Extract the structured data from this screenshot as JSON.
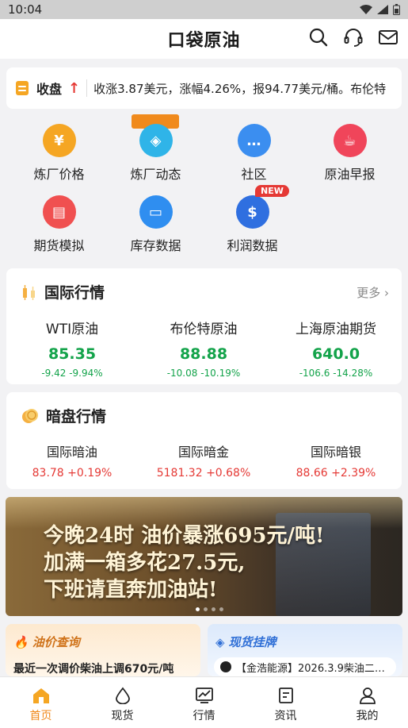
{
  "status": {
    "time": "10:04"
  },
  "header": {
    "logo_text": "口袋原油"
  },
  "ticker": {
    "label": "收盘",
    "text": "收涨3.87美元，涨幅4.26%，报94.77美元/桶。布伦特"
  },
  "grid": [
    {
      "label": "炼厂价格",
      "icon": "refinery-price-icon",
      "color": "#f5a623",
      "glyph": "¥"
    },
    {
      "label": "炼厂动态",
      "icon": "compass-icon",
      "color": "#2fb4e8",
      "glyph": "◈"
    },
    {
      "label": "社区",
      "icon": "chat-icon",
      "color": "#3b8ef0",
      "glyph": "…"
    },
    {
      "label": "原油早报",
      "icon": "cup-icon",
      "color": "#f0455a",
      "glyph": "☕"
    },
    {
      "label": "期货模拟",
      "icon": "gold-bars-icon",
      "color": "#f05050",
      "glyph": "▤"
    },
    {
      "label": "库存数据",
      "icon": "monitor-icon",
      "color": "#2f8ef0",
      "glyph": "▭"
    },
    {
      "label": "利润数据",
      "icon": "dollar-icon",
      "color": "#2f6fe0",
      "glyph": "$",
      "badge": "NEW"
    }
  ],
  "intl": {
    "title": "国际行情",
    "more": "更多",
    "items": [
      {
        "name": "WTI原油",
        "price": "85.35",
        "change": "-9.42  -9.94%"
      },
      {
        "name": "布伦特原油",
        "price": "88.88",
        "change": "-10.08  -10.19%"
      },
      {
        "name": "上海原油期货",
        "price": "640.0",
        "change": "-106.6  -14.28%"
      }
    ]
  },
  "dark": {
    "title": "暗盘行情",
    "items": [
      {
        "name": "国际暗油",
        "value": "83.78 +0.19%"
      },
      {
        "name": "国际暗金",
        "value": "5181.32 +0.68%"
      },
      {
        "name": "国际暗银",
        "value": "88.66 +2.39%"
      }
    ]
  },
  "banner": {
    "line1": "今晚24时 油价暴涨695元/吨!",
    "line2": "加满一箱多花27.5元,",
    "line3": "下班请直奔加油站!"
  },
  "promo_left": {
    "title": "油价查询",
    "subtitle": "最近一次调价柴油上调670元/吨"
  },
  "promo_right": {
    "title": "现货挂牌",
    "news": "【金浩能源】2026.3.9柴油二…"
  },
  "tabs": [
    {
      "label": "首页",
      "icon": "home-icon",
      "active": true
    },
    {
      "label": "现货",
      "icon": "drop-icon",
      "active": false
    },
    {
      "label": "行情",
      "icon": "chart-icon",
      "active": false
    },
    {
      "label": "资讯",
      "icon": "news-icon",
      "active": false
    },
    {
      "label": "我的",
      "icon": "profile-icon",
      "active": false
    }
  ]
}
